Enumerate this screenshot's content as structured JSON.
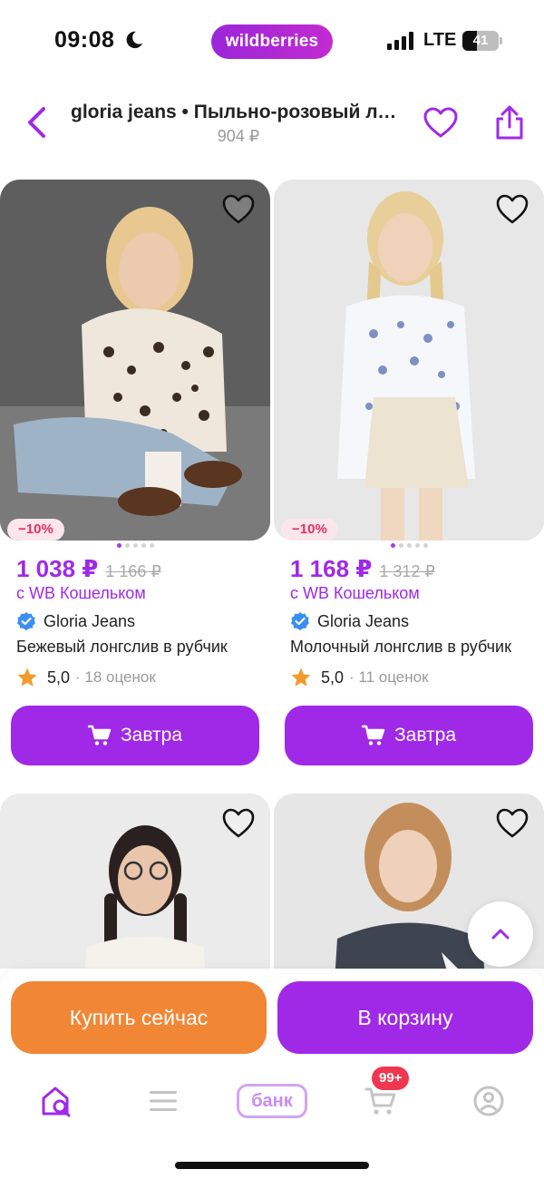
{
  "status_bar": {
    "time": "09:08",
    "network": "LTE",
    "battery": "41",
    "battery_level": 0.41,
    "app_badge": "wildberries"
  },
  "header": {
    "title": "gloria jeans • Пыльно-розовый лонгслив",
    "price": "904 ₽"
  },
  "products": [
    {
      "discount": "−10%",
      "price": "1 038 ₽",
      "old_price": "1 166 ₽",
      "wallet": "с WB Кошельком",
      "brand": "Gloria Jeans",
      "name": "Бежевый лонгслив в рубчик",
      "rating": "5,0",
      "reviews": "· 18 оценок",
      "cart_label": "Завтра"
    },
    {
      "discount": "−10%",
      "price": "1 168 ₽",
      "old_price": "1 312 ₽",
      "wallet": "с WB Кошельком",
      "brand": "Gloria Jeans",
      "name": "Молочный лонгслив в рубчик",
      "rating": "5,0",
      "reviews": "· 11 оценок",
      "cart_label": "Завтра"
    }
  ],
  "bottom": {
    "buy_now": "Купить сейчас",
    "to_cart": "В корзину",
    "bank": "банк",
    "cart_badge": "99+"
  },
  "colors": {
    "accent": "#a029e8",
    "orange": "#f18635",
    "discount": "#e52f62",
    "badge": "#f1364f"
  },
  "icons": [
    "back-arrow-icon",
    "heart-icon",
    "share-icon",
    "verified-icon",
    "star-icon",
    "cart-icon",
    "chevron-up-icon",
    "home-search-icon",
    "menu-icon",
    "profile-icon"
  ]
}
